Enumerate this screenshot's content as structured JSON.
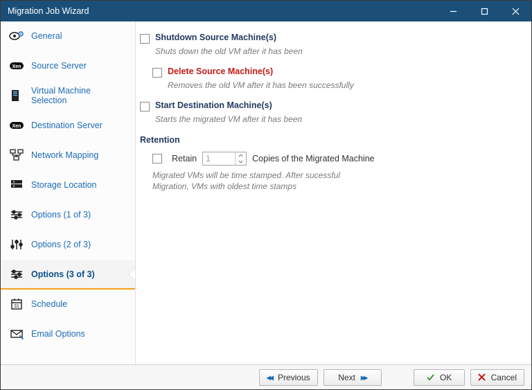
{
  "window": {
    "title": "Migration Job Wizard"
  },
  "sidebar": {
    "items": [
      {
        "label": "General"
      },
      {
        "label": "Source Server"
      },
      {
        "label": "Virtual Machine Selection"
      },
      {
        "label": "Destination Server"
      },
      {
        "label": "Network Mapping"
      },
      {
        "label": "Storage Location"
      },
      {
        "label": "Options (1 of 3)"
      },
      {
        "label": "Options (2 of 3)"
      },
      {
        "label": "Options (3 of 3)"
      },
      {
        "label": "Schedule"
      },
      {
        "label": "Email Options"
      }
    ],
    "activeIndex": 8
  },
  "options": {
    "shutdown": {
      "title": "Shutdown Source Machine(s)",
      "desc": "Shuts down the old VM after it has been"
    },
    "delete": {
      "title": "Delete Source Machine(s)",
      "desc": "Removes the old VM after it has been successfully"
    },
    "startDest": {
      "title": "Start Destination Machine(s)",
      "desc": "Starts the migrated VM after it has been"
    },
    "retention": {
      "heading": "Retention",
      "retainLabel": "Retain",
      "copiesLabel": "Copies of the Migrated Machine",
      "value": "1",
      "note": "Migrated VMs will be time stamped. After sucessful Migration, VMs with oldest time stamps"
    }
  },
  "footer": {
    "previous": "Previous",
    "next": "Next",
    "ok": "OK",
    "cancel": "Cancel"
  }
}
